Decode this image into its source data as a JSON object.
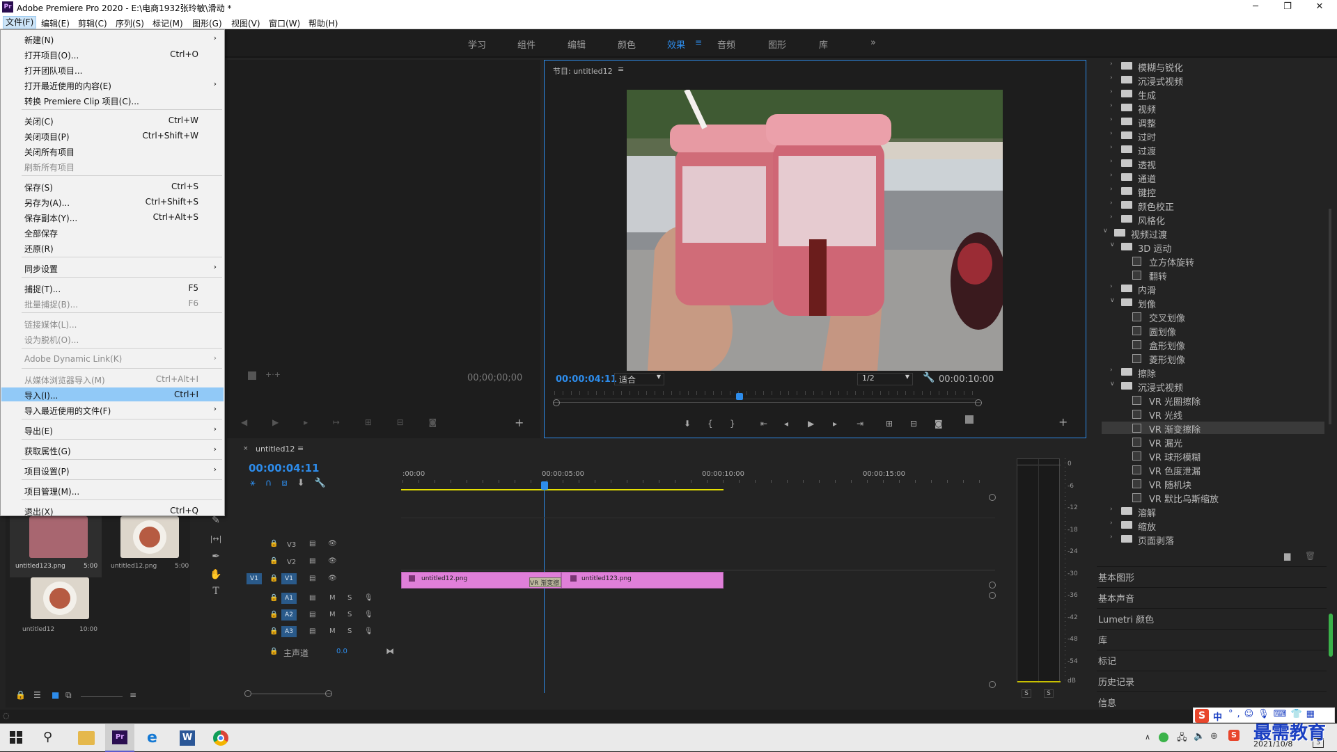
{
  "window": {
    "title": "Adobe Premiere Pro 2020 - E:\\电商1932张玲敏\\滑动 *",
    "minimize": "─",
    "maximize": "❐",
    "close": "✕"
  },
  "menubar": [
    "文件(F)",
    "编辑(E)",
    "剪辑(C)",
    "序列(S)",
    "标记(M)",
    "图形(G)",
    "视图(V)",
    "窗口(W)",
    "帮助(H)"
  ],
  "workspaces": [
    "学习",
    "组件",
    "编辑",
    "颜色",
    "效果",
    "音频",
    "图形",
    "库",
    "»"
  ],
  "file_menu": [
    {
      "label": "新建(N)",
      "arrow": "›"
    },
    {
      "label": "打开项目(O)...",
      "shortcut": "Ctrl+O"
    },
    {
      "label": "打开团队项目..."
    },
    {
      "label": "打开最近使用的内容(E)",
      "arrow": "›"
    },
    {
      "label": "转换 Premiere Clip 项目(C)..."
    },
    {
      "label": "关闭(C)",
      "shortcut": "Ctrl+W"
    },
    {
      "label": "关闭项目(P)",
      "shortcut": "Ctrl+Shift+W"
    },
    {
      "label": "关闭所有项目"
    },
    {
      "label": "刷新所有项目"
    },
    {
      "label": "保存(S)",
      "shortcut": "Ctrl+S"
    },
    {
      "label": "另存为(A)...",
      "shortcut": "Ctrl+Shift+S"
    },
    {
      "label": "保存副本(Y)...",
      "shortcut": "Ctrl+Alt+S"
    },
    {
      "label": "全部保存"
    },
    {
      "label": "还原(R)"
    },
    {
      "label": "同步设置",
      "arrow": "›"
    },
    {
      "label": "捕捉(T)...",
      "shortcut": "F5"
    },
    {
      "label": "批量捕捉(B)...",
      "shortcut": "F6"
    },
    {
      "label": "链接媒体(L)..."
    },
    {
      "label": "设为脱机(O)..."
    },
    {
      "label": "Adobe Dynamic Link(K)",
      "arrow": "›"
    },
    {
      "label": "从媒体浏览器导入(M)",
      "shortcut": "Ctrl+Alt+I"
    },
    {
      "label": "导入(I)...",
      "shortcut": "Ctrl+I"
    },
    {
      "label": "导入最近使用的文件(F)",
      "arrow": "›"
    },
    {
      "label": "导出(E)",
      "arrow": "›"
    },
    {
      "label": "获取属性(G)",
      "arrow": "›"
    },
    {
      "label": "项目设置(P)",
      "arrow": "›"
    },
    {
      "label": "项目管理(M)..."
    },
    {
      "label": "退出(X)",
      "shortcut": "Ctrl+Q"
    }
  ],
  "source_monitor": {
    "timecode": "00;00;00;00"
  },
  "program_monitor": {
    "tab": "节目: untitled12",
    "timecode": "00:00:04:11",
    "fit": "适合",
    "resolution": "1/2",
    "duration": "00:00:10:00"
  },
  "project": {
    "items": [
      {
        "name": "untitled123.png",
        "duration": "5:00"
      },
      {
        "name": "untitled12.png",
        "duration": "5:00"
      },
      {
        "name": "untitled12",
        "duration": "10:00"
      }
    ]
  },
  "timeline": {
    "tab": "untitled12",
    "timecode": "00:00:04:11",
    "ruler": [
      ":00:00",
      "00:00:05:00",
      "00:00:10:00",
      "00:00:15:00"
    ],
    "video_tracks": [
      "V3",
      "V2",
      "V1"
    ],
    "audio_tracks": [
      "A1",
      "A2",
      "A3"
    ],
    "source_v": "V1",
    "track_buttons": {
      "mute": "M",
      "solo": "S"
    },
    "master": {
      "label": "主声道",
      "value": "0.0"
    },
    "clips": [
      {
        "name": "untitled12.png"
      },
      {
        "name": "untitled123.png"
      }
    ],
    "transition": "VR 渐变擦"
  },
  "audio_meter": {
    "scale": [
      "0",
      "-6",
      "-12",
      "-18",
      "-24",
      "-30",
      "-36",
      "-42",
      "-48",
      "-54",
      "dB"
    ],
    "solo": [
      "S",
      "S"
    ]
  },
  "effects": {
    "rows": [
      {
        "type": "folder",
        "label": "模糊与锐化",
        "level": 1,
        "open": false
      },
      {
        "type": "folder",
        "label": "沉浸式视频",
        "level": 1,
        "open": false
      },
      {
        "type": "folder",
        "label": "生成",
        "level": 1,
        "open": false
      },
      {
        "type": "folder",
        "label": "视频",
        "level": 1,
        "open": false
      },
      {
        "type": "folder",
        "label": "调整",
        "level": 1,
        "open": false
      },
      {
        "type": "folder",
        "label": "过时",
        "level": 1,
        "open": false
      },
      {
        "type": "folder",
        "label": "过渡",
        "level": 1,
        "open": false
      },
      {
        "type": "folder",
        "label": "透视",
        "level": 1,
        "open": false
      },
      {
        "type": "folder",
        "label": "通道",
        "level": 1,
        "open": false
      },
      {
        "type": "folder",
        "label": "键控",
        "level": 1,
        "open": false
      },
      {
        "type": "folder",
        "label": "颜色校正",
        "level": 1,
        "open": false
      },
      {
        "type": "folder",
        "label": "风格化",
        "level": 1,
        "open": false
      },
      {
        "type": "folder",
        "label": "视频过渡",
        "level": 0,
        "open": true
      },
      {
        "type": "folder",
        "label": "3D 运动",
        "level": 1,
        "open": true
      },
      {
        "type": "preset",
        "label": "立方体旋转",
        "level": 2
      },
      {
        "type": "preset",
        "label": "翻转",
        "level": 2
      },
      {
        "type": "folder",
        "label": "内滑",
        "level": 1,
        "open": false
      },
      {
        "type": "folder",
        "label": "划像",
        "level": 1,
        "open": true
      },
      {
        "type": "preset",
        "label": "交叉划像",
        "level": 2
      },
      {
        "type": "preset",
        "label": "圆划像",
        "level": 2
      },
      {
        "type": "preset",
        "label": "盒形划像",
        "level": 2
      },
      {
        "type": "preset",
        "label": "菱形划像",
        "level": 2
      },
      {
        "type": "folder",
        "label": "擦除",
        "level": 1,
        "open": false
      },
      {
        "type": "folder",
        "label": "沉浸式视频",
        "level": 1,
        "open": true
      },
      {
        "type": "preset",
        "label": "VR 光圈擦除",
        "level": 2
      },
      {
        "type": "preset",
        "label": "VR 光线",
        "level": 2
      },
      {
        "type": "preset",
        "label": "VR 渐变擦除",
        "level": 2,
        "selected": true
      },
      {
        "type": "preset",
        "label": "VR 漏光",
        "level": 2
      },
      {
        "type": "preset",
        "label": "VR 球形模糊",
        "level": 2
      },
      {
        "type": "preset",
        "label": "VR 色度泄漏",
        "level": 2
      },
      {
        "type": "preset",
        "label": "VR 随机块",
        "level": 2
      },
      {
        "type": "preset",
        "label": "VR 默比乌斯缩放",
        "level": 2
      },
      {
        "type": "folder",
        "label": "溶解",
        "level": 1,
        "open": false
      },
      {
        "type": "folder",
        "label": "缩放",
        "level": 1,
        "open": false
      },
      {
        "type": "folder",
        "label": "页面剥落",
        "level": 1,
        "open": false
      }
    ]
  },
  "panels": [
    "基本图形",
    "基本声音",
    "Lumetri 颜色",
    "库",
    "标记",
    "历史记录",
    "信息"
  ],
  "taskbar": {
    "ime": "中",
    "date": "2021/10/8",
    "watermark": "最需教育",
    "notify": "3"
  },
  "colors": {
    "accent": "#2d8ceb",
    "clip": "#e07fd9",
    "menu_highlight": "#91c9f7"
  }
}
